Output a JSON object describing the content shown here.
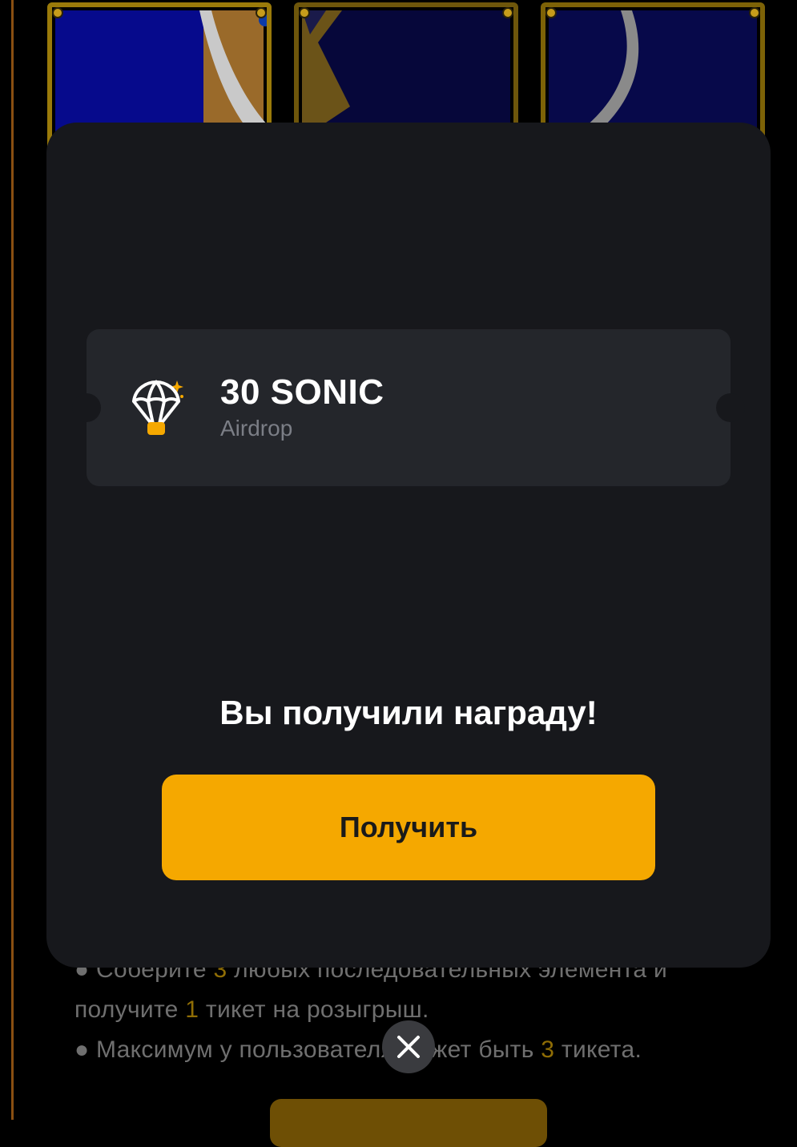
{
  "background": {
    "rules": {
      "line1_prefix": "● Соберите ",
      "line1_num": "3",
      "line1_suffix": " любых последовательных элемента и",
      "line2_prefix": "получите ",
      "line2_num": "1",
      "line2_suffix": " тикет на розыгрыш.",
      "line3_prefix": "● Максимум у пользователя может быть ",
      "line3_num": "3",
      "line3_suffix": " тикета."
    }
  },
  "modal": {
    "reward": {
      "amount": "30 SONIC",
      "type": "Airdrop",
      "icon": "parachute-airdrop-icon"
    },
    "title": "Вы получили награду!",
    "claim_label": "Получить"
  },
  "colors": {
    "accent": "#f5a800",
    "modal_bg": "#17181c",
    "ticket_bg": "#24262b"
  }
}
